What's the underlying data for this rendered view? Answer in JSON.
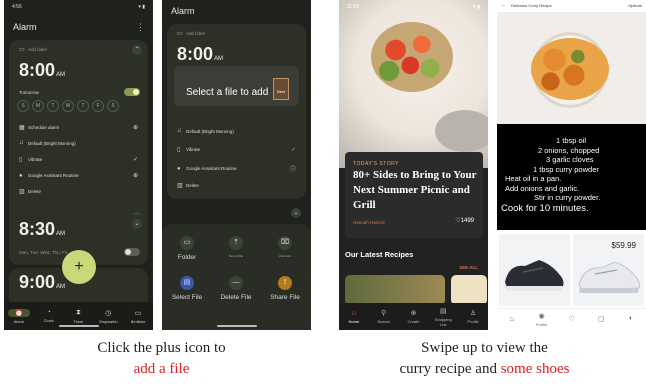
{
  "panel1": {
    "status_time": "4:56",
    "app_title": "Alarm",
    "add_label": "Add label",
    "alarm1_time": "8:00",
    "alarm1_ampm": "AM",
    "alarm1_sub": "Tomorrow",
    "days": [
      "S",
      "M",
      "T",
      "W",
      "T",
      "F",
      "S"
    ],
    "actions": [
      {
        "icon": "calendar-icon",
        "label": "Schedule alarm",
        "right": "⊕"
      },
      {
        "icon": "bell-icon",
        "label": "Default (Bright Morning)",
        "right": ""
      },
      {
        "icon": "vibrate-icon",
        "label": "Vibrate",
        "right": "✓"
      },
      {
        "icon": "assistant-icon",
        "label": "Google Assistant Routine",
        "right": "⊕"
      },
      {
        "icon": "trash-icon",
        "label": "Delete",
        "right": ""
      }
    ],
    "alarm2_time": "8:30",
    "alarm2_ampm": "AM",
    "alarm2_sub": "Mon, Tue, Wed, Thu, Fri",
    "alarm3_time": "9:00",
    "alarm3_ampm": "AM",
    "fab_symbol": "+",
    "nav": [
      {
        "label": "Alarm",
        "icon": "⏰"
      },
      {
        "label": "Clock",
        "icon": "◔"
      },
      {
        "label": "Timer",
        "icon": "⧗"
      },
      {
        "label": "Stopwatch",
        "icon": "◷"
      },
      {
        "label": "Bedtime",
        "icon": "▭"
      }
    ]
  },
  "panel2": {
    "app_title": "Alarm",
    "add_label": "Add label",
    "alarm_time": "8:00",
    "alarm_ampm": "AM",
    "popup_text": "Select a file to add",
    "popup_thumb": "Next",
    "actions": [
      {
        "label": "Default (Bright Morning)",
        "right": ""
      },
      {
        "label": "Vibrate",
        "right": "✓"
      },
      {
        "label": "Google Assistant Routine",
        "right": "ⓘ"
      },
      {
        "label": "Delete",
        "right": ""
      }
    ],
    "sheet_top": [
      {
        "label": "Folder",
        "icon": "▭"
      },
      {
        "label": "Record file",
        "icon": "⤒"
      },
      {
        "label": "Unknown",
        "icon": "⌧"
      }
    ],
    "sheet_bottom": [
      {
        "label": "Select File",
        "icon": "▤"
      },
      {
        "label": "Delete File",
        "icon": "—"
      },
      {
        "label": "Share File",
        "icon": "⇪"
      }
    ]
  },
  "panel3": {
    "status_time": "11:29",
    "kicker": "TODAY'S STORY",
    "headline": "80+ Sides to Bring to Your Next Summer Picnic and Grill",
    "author": "Hannah Hamrol",
    "likes": "♡1499",
    "section": "Our Latest Recipes",
    "see_all": "SEE ALL",
    "nav": [
      {
        "label": "Home",
        "icon": "⌂"
      },
      {
        "label": "Search",
        "icon": "⚲"
      },
      {
        "label": "Create",
        "icon": "⊕"
      },
      {
        "label": "Shopping List",
        "icon": "▤"
      },
      {
        "label": "Profile",
        "icon": "♙"
      }
    ]
  },
  "panel4": {
    "page_title": "Delicious Curry Recipe",
    "options": "Options",
    "recipe_lines": [
      "1 tbsp oil",
      "2 onions, chopped",
      "3 garlic cloves",
      "1 tbsp curry powder",
      "Heat oil in a pan.",
      "Add onions and garlic.",
      "Stir in curry powder.",
      "Cook for 10 minutes."
    ],
    "price": "$59.99",
    "nav": [
      {
        "label": "",
        "icon": "♨"
      },
      {
        "label": "Profile",
        "icon": "◉"
      },
      {
        "label": "",
        "icon": "♡"
      },
      {
        "label": "",
        "icon": "▢"
      },
      {
        "label": "",
        "icon": "◐"
      }
    ]
  },
  "captions": {
    "left_line1": "Click the plus icon  to",
    "left_line2": "add a file",
    "right_line1": "Swipe up to view the",
    "right_line2_a": "curry recipe and ",
    "right_line2_b": "some shoes"
  },
  "colors": {
    "accent_lime": "#c9d879",
    "caption_red": "#e02020",
    "recipe_orange": "#e2734a"
  }
}
